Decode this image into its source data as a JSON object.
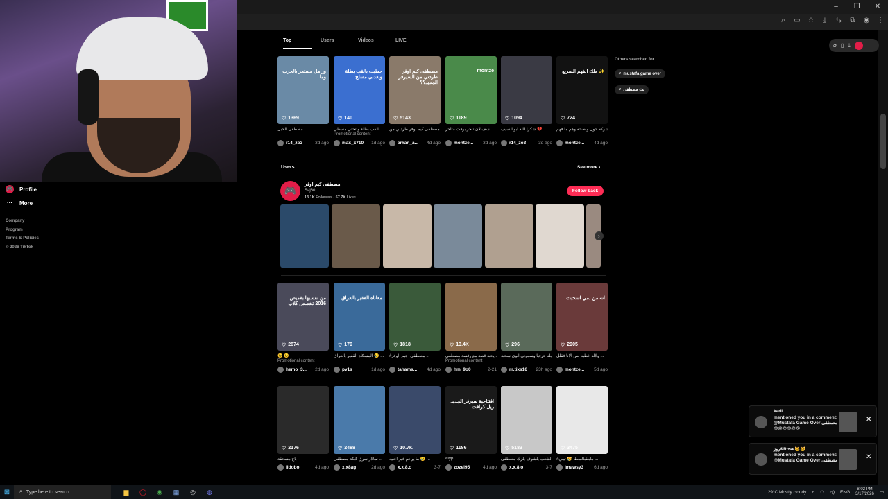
{
  "window": {
    "minimize": "–",
    "maximize": "❐",
    "close": "✕"
  },
  "tabs": [
    "Top",
    "Users",
    "Videos",
    "LIVE"
  ],
  "others": {
    "title": "Others searched for",
    "chips": [
      "mustafa game over",
      "بث مصطفى"
    ]
  },
  "sidebar": {
    "items": [
      {
        "label": "Profile",
        "icon": "profile-icon"
      },
      {
        "label": "More",
        "icon": "more-icon"
      }
    ],
    "footer": [
      "Company",
      "Program",
      "Terms & Policies",
      "© 2026 TikTok"
    ]
  },
  "row1": [
    {
      "likes": "1369",
      "caption": "مصطفى الحبل ...",
      "promo": "",
      "user": "r14_zo3",
      "age": "3d ago",
      "thumb_text": "ور هل مستمر بالحرب وما",
      "color": "#6a8aa6"
    },
    {
      "likes": "140",
      "caption": "بالقب بطلة وبتحتي مسطي ...",
      "promo": "Promotional content",
      "user": "max_x710",
      "age": "1d ago",
      "thumb_text": "حطيت بالقب بطلة وبعدني مسلح",
      "color": "#3b6fd0"
    },
    {
      "likes": "5143",
      "caption": "مصطفى كيم اوفر طردني من ...",
      "promo": "",
      "user": "arkan_a...",
      "age": "4d ago",
      "thumb_text": "مصطفى كيم اوفر طردني من السيرفر الجديد؟؟",
      "color": "#8a7a6a"
    },
    {
      "likes": "1189",
      "caption": "اسف لان تاخر بوقت متأخر ...",
      "promo": "",
      "user": "montze...",
      "age": "3d ago",
      "thumb_text": "montze",
      "color": "#4a8a4a"
    },
    {
      "likes": "1094",
      "caption": "شكرا الله ابو السيف 💔 ...",
      "promo": "",
      "user": "r14_zo3",
      "age": "3d ago",
      "thumb_text": "",
      "color": "#3a3a44"
    },
    {
      "likes": "724",
      "caption": "شركه حول واضحه وهم ما فهم ...",
      "promo": "",
      "user": "montze...",
      "age": "4d ago",
      "thumb_text": "ملك الفهم السريع ✨",
      "color": "#121212"
    }
  ],
  "users": {
    "heading": "Users",
    "see_more": "See more",
    "name": "مصطفى كيم اوفر",
    "handle": "Saj60",
    "followers": "13.1K",
    "followers_label": "Followers",
    "likes": "57.7K",
    "likes_label": "Likes",
    "follow": "Follow back",
    "avatar_glyph": "🎮",
    "photos": [
      "#2b4a6a",
      "#6a5a4a",
      "#c8b8a8",
      "#7a8a9a",
      "#b0a090",
      "#e0d8d0",
      "#9a8a80"
    ]
  },
  "row2": [
    {
      "likes": "2874",
      "caption": "😉 😉",
      "promo": "Promotional content",
      "user": "hemo_3...",
      "age": "2d ago",
      "thumb_text": "من نفسبها بقميص 2016 تخصص كلاب",
      "color": "#4a4a5a"
    },
    {
      "likes": "179",
      "caption": "المسكاة القفير بالعراق 😢 ... I",
      "promo": "",
      "user": "pv1s_",
      "age": "1d ago",
      "thumb_text": "معاناة الفقير بالعراق",
      "color": "#3a6a9a"
    },
    {
      "likes": "1818",
      "caption": "#مصطفى_جيم_اوفر ...",
      "promo": "",
      "user": "tahama...",
      "age": "4d ago",
      "thumb_text": "",
      "color": "#3a5a3a"
    },
    {
      "likes": "13.4K",
      "caption": "يحبه قصة مع رفسة مصطفى ...",
      "promo": "Promotional content",
      "user": "hm_9o0",
      "age": "2-21",
      "thumb_text": "",
      "color": "#8a6a4a"
    },
    {
      "likes": "296",
      "caption": "ابله حرفياً وسموني ابوي سحبة ...",
      "promo": "",
      "user": "m.tixs16",
      "age": "23h ago",
      "thumb_text": "",
      "color": "#5a6a5a"
    },
    {
      "likes": "2905",
      "caption": "ولأله خطيه نص الانا فقلل ...",
      "promo": "",
      "user": "montze...",
      "age": "5d ago",
      "thumb_text": "انه من بمي اسحبت",
      "color": "#6a3a3a"
    }
  ],
  "row3": [
    {
      "likes": "2176",
      "caption": "باخ مسحقة",
      "user": "iidobo",
      "age": "4d ago",
      "thumb_text": "",
      "color": "#2a2a2a"
    },
    {
      "likes": "2488",
      "caption": "سالار سرق كيكة مصطفى ...",
      "user": "xix8ag",
      "age": "2d ago",
      "thumb_text": "",
      "color": "#4a7aaa"
    },
    {
      "likes": "10.7K",
      "caption": "ما يرحم غير اعنيه 😢 ...",
      "user": "x.x.8.o",
      "age": "3-7",
      "thumb_text": "",
      "color": "#3a4a6a"
    },
    {
      "likes": "1186",
      "caption": "#fyp ...",
      "user": "zozei95",
      "age": "4d ago",
      "thumb_text": "افتتاحية سيرفر الجديد ريل كرافت",
      "color": "#1a1a1a"
    },
    {
      "likes": "5183",
      "caption": "الشعب يلشوف يلزك مصطفى ...",
      "user": "x.x.8.o",
      "age": "3-7",
      "thumb_text": "",
      "color": "#c8c8c8"
    },
    {
      "likes": "3475",
      "caption": "#مابنقبالسطا 😿 تيني ...",
      "user": "imawsy3",
      "age": "6d ago",
      "thumb_text": "",
      "color": "#e8e8e8"
    }
  ],
  "notifications": [
    {
      "name": "kadi",
      "message": "mentioned you in a comment: @Mustafa Game Over مصطفى @@@@@@",
      "close": "✕"
    },
    {
      "name": "روز&Rose🐱🐱",
      "message": "mentioned you in a comment: @Mustafa Game Over مصطفى",
      "close": "✕"
    }
  ],
  "taskbar": {
    "search_placeholder": "Type here to search",
    "weather": "29°C  Mostly cloudy",
    "lang": "ENG",
    "time": "8:02 PM",
    "date": "3/17/2026"
  }
}
